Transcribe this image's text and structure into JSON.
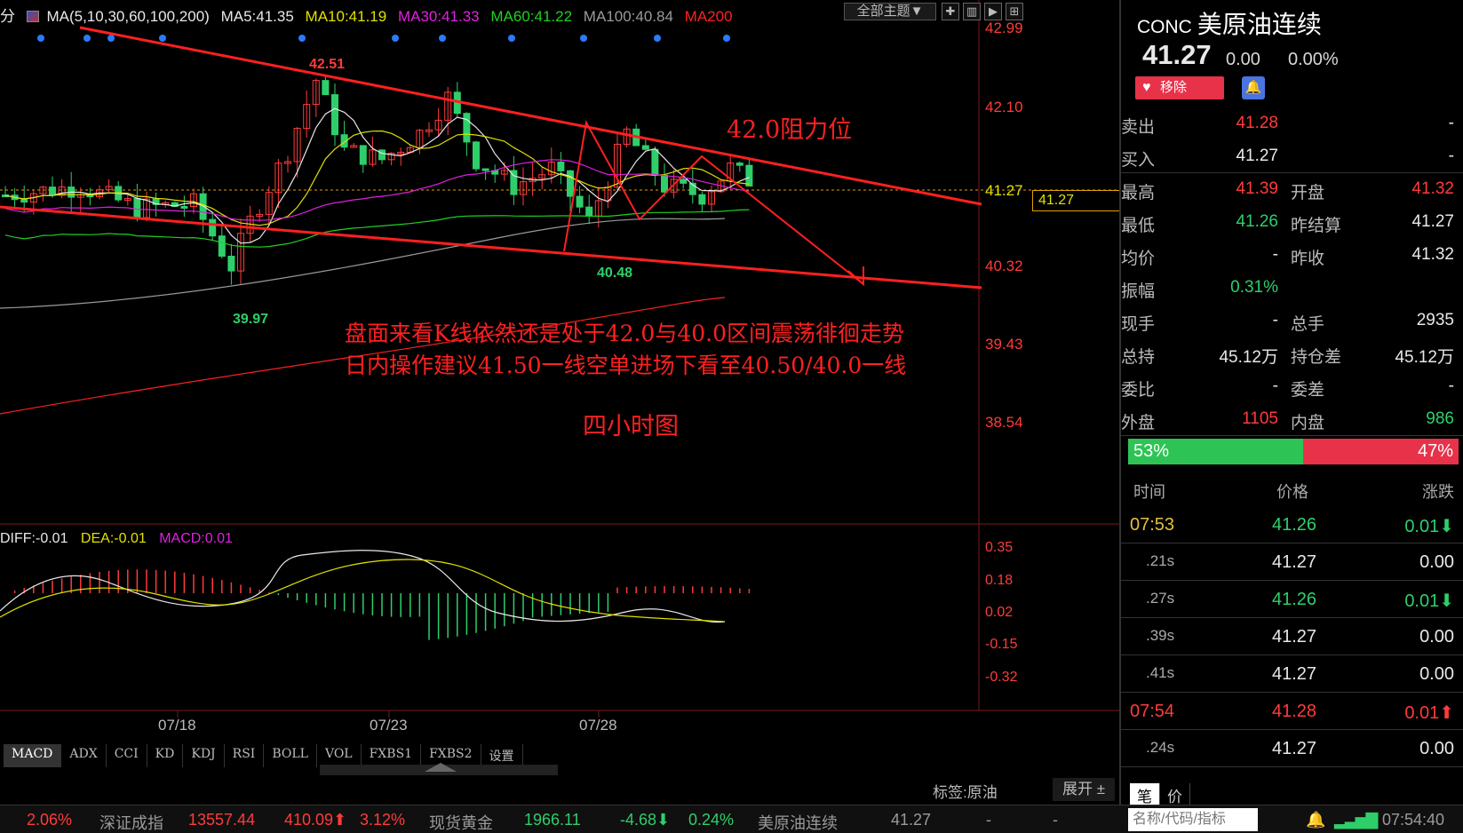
{
  "legend": {
    "period": "分",
    "ma_title": "MA(5,10,30,60,100,200)",
    "ma5": "MA5:41.35",
    "ma10": "MA10:41.19",
    "ma30": "MA30:41.33",
    "ma60": "MA60:41.22",
    "ma100": "MA100:40.84",
    "ma200": "MA200"
  },
  "colors": {
    "bull": "#ff3b3b",
    "bear": "#2ecf6a",
    "ma5": "#e8e8e8",
    "ma10": "#e0e000",
    "ma30": "#e020e0",
    "ma60": "#20d020",
    "ma100": "#9a9a9a",
    "ma200": "#ff2020"
  },
  "toolbar": {
    "theme_label": "全部主题▼"
  },
  "price_axis": [
    "42.99",
    "42.10",
    "41.27",
    "40.32",
    "39.43",
    "38.54"
  ],
  "current_price_tag": "41.27",
  "chart_labels": {
    "high_label": "42.51",
    "low_label_1": "39.97",
    "low_label_2": "40.48"
  },
  "annotations": {
    "resistance": "42.0阻力位",
    "line1": "盘面来看K线依然还是处于42.0与40.0区间震荡徘徊走势",
    "line2": "日内操作建议41.50一线空单进场下看至40.50/40.0一线",
    "line3": "四小时图"
  },
  "macd": {
    "diff": "DIFF:-0.01",
    "dea": "DEA:-0.01",
    "macd": "MACD:0.01",
    "axis": [
      "0.35",
      "0.18",
      "0.02",
      "-0.15",
      "-0.32"
    ]
  },
  "x_axis": [
    "07/18",
    "07/23",
    "07/28"
  ],
  "indicator_tabs": [
    "MACD",
    "ADX",
    "CCI",
    "KD",
    "KDJ",
    "RSI",
    "BOLL",
    "VOL",
    "FXBS1",
    "FXBS2",
    "设置"
  ],
  "footer": {
    "tag_label": "标签:原油",
    "expand_label": "展开 ±"
  },
  "quote": {
    "code": "CONC",
    "name": "美原油连续",
    "price": "41.27",
    "change": "0.00",
    "change_pct": "0.00%",
    "fav_label": "移除",
    "rows": [
      {
        "l1": "卖出",
        "v1": "41.28",
        "c1": "red",
        "l2": "",
        "v2": "-",
        "c2": "white"
      },
      {
        "l1": "买入",
        "v1": "41.27",
        "c1": "white",
        "l2": "",
        "v2": "-",
        "c2": "white"
      },
      {
        "l1": "最高",
        "v1": "41.39",
        "c1": "red",
        "l2": "开盘",
        "v2": "41.32",
        "c2": "red"
      },
      {
        "l1": "最低",
        "v1": "41.26",
        "c1": "green",
        "l2": "昨结算",
        "v2": "41.27",
        "c2": "white"
      },
      {
        "l1": "均价",
        "v1": "-",
        "c1": "white",
        "l2": "昨收",
        "v2": "41.32",
        "c2": "white"
      },
      {
        "l1": "振幅",
        "v1": "0.31%",
        "c1": "green",
        "l2": "",
        "v2": "",
        "c2": "white"
      },
      {
        "l1": "现手",
        "v1": "-",
        "c1": "white",
        "l2": "总手",
        "v2": "2935",
        "c2": "white"
      },
      {
        "l1": "总持",
        "v1": "45.12万",
        "c1": "white",
        "l2": "持仓差",
        "v2": "45.12万",
        "c2": "white"
      },
      {
        "l1": "委比",
        "v1": "-",
        "c1": "white",
        "l2": "委差",
        "v2": "-",
        "c2": "white"
      },
      {
        "l1": "外盘",
        "v1": "1105",
        "c1": "red",
        "l2": "内盘",
        "v2": "986",
        "c2": "green"
      }
    ],
    "buy_pct": "53%",
    "sell_pct": "47%",
    "buy_fraction": 0.53
  },
  "ticks": {
    "headers": [
      "时间",
      "价格",
      "涨跌"
    ],
    "rows": [
      {
        "time": "07:53",
        "sub": false,
        "price": "41.26",
        "pc": "green",
        "chg": "0.01⬇",
        "cc": "green"
      },
      {
        "time": ".21s",
        "sub": true,
        "price": "41.27",
        "pc": "white",
        "chg": "0.00",
        "cc": "white"
      },
      {
        "time": ".27s",
        "sub": true,
        "price": "41.26",
        "pc": "green",
        "chg": "0.01⬇",
        "cc": "green"
      },
      {
        "time": ".39s",
        "sub": true,
        "price": "41.27",
        "pc": "white",
        "chg": "0.00",
        "cc": "white"
      },
      {
        "time": ".41s",
        "sub": true,
        "price": "41.27",
        "pc": "white",
        "chg": "0.00",
        "cc": "white"
      },
      {
        "time": "07:54",
        "sub": false,
        "price": "41.28",
        "pc": "red",
        "chg": "0.01⬆",
        "cc": "red"
      },
      {
        "time": ".24s",
        "sub": true,
        "price": "41.27",
        "pc": "white",
        "chg": "0.00",
        "cc": "white"
      }
    ],
    "bottom_tabs": [
      "笔",
      "价"
    ]
  },
  "status": {
    "s1": "2.06%",
    "idx_name": "深证成指",
    "idx_val": "13557.44",
    "idx_chg": "410.09⬆",
    "idx_pct": "3.12%",
    "gold_name": "现货黄金",
    "gold_val": "1966.11",
    "gold_chg": "-4.68⬇",
    "gold_pct": "0.24%",
    "oil_name": "美原油连续",
    "oil_val": "41.27",
    "dash1": "-",
    "dash2": "-",
    "search_placeholder": "名称/代码/指标",
    "clock": "07:54:40"
  }
}
